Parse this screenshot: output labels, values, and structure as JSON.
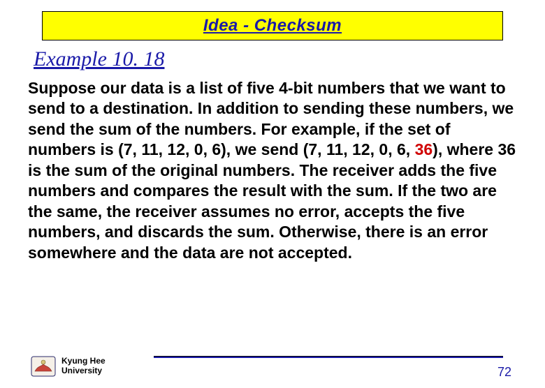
{
  "title": "Idea - Checksum",
  "example_label": "Example 10. 18",
  "body": {
    "p1": "Suppose our data is a list of five 4-bit numbers that we want to send to a destination. In addition to sending these numbers, we send the sum of the numbers. For example, if the set of numbers is (7, 11, 12, 0, 6), we send (7, 11, 12, 0, 6, ",
    "highlight": "36",
    "p2": "), where 36 is the sum of the original numbers. The receiver adds the five numbers and compares the result with the sum. If the two are the same, the receiver assumes no error, accepts the five numbers, and discards the sum. Otherwise, there is an error somewhere and the data are not accepted."
  },
  "footer": {
    "uni_line1": "Kyung Hee",
    "uni_line2": "University",
    "page": "72"
  },
  "colors": {
    "accent": "#1a1aa8",
    "title_bg": "#ffff00",
    "highlight": "#d00000"
  }
}
